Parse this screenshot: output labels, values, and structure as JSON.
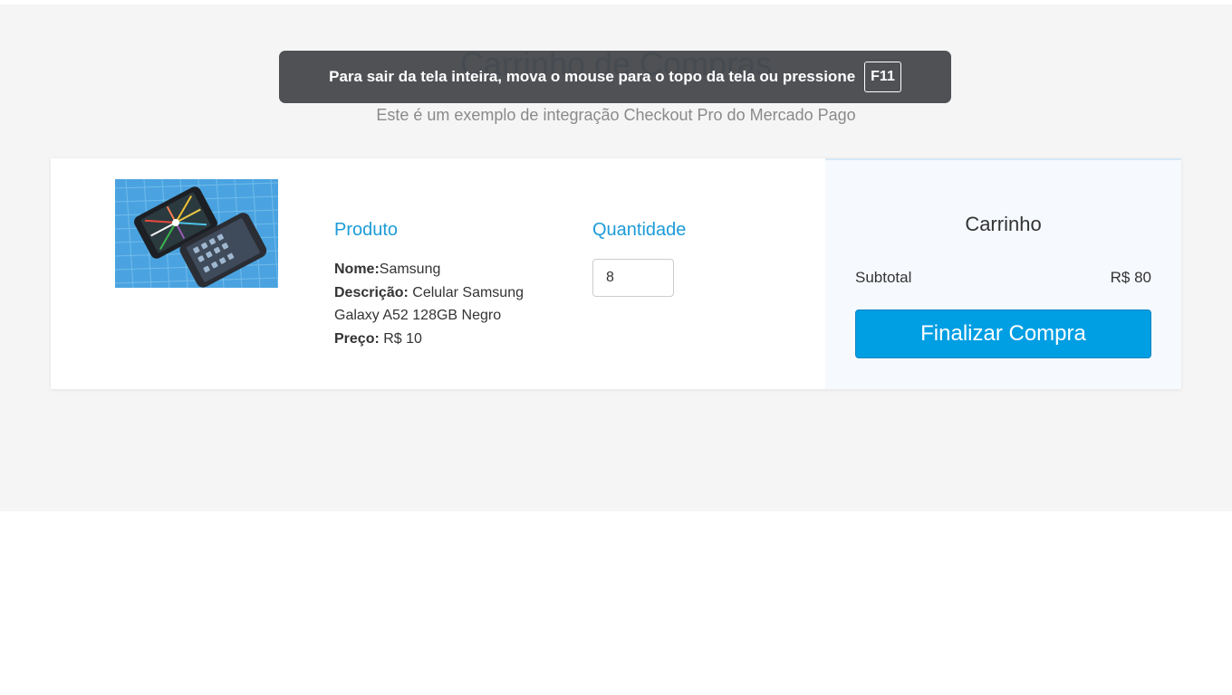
{
  "page": {
    "title": "Carrinho de Compras",
    "subtitle": "Este é um exemplo de integração Checkout Pro do Mercado Pago"
  },
  "fullscreen_notice": {
    "text": "Para sair da tela inteira, mova o mouse para o topo da tela ou pressione",
    "key": "F11"
  },
  "product": {
    "image_icon": "smartphones-photo",
    "section_title": "Produto",
    "name_label": "Nome:",
    "name_value": "Samsung",
    "description_label": "Descrição:",
    "description_value": " Celular Samsung Galaxy A52 128GB Negro",
    "price_label": "Preço:",
    "price_value": " R$ 10"
  },
  "quantity": {
    "section_title": "Quantidade",
    "value": "8"
  },
  "summary": {
    "title": "Carrinho",
    "subtotal_label": "Subtotal",
    "subtotal_value": "R$ 80",
    "checkout_label": "Finalizar Compra"
  },
  "colors": {
    "accent": "#009ee3",
    "section_title": "#1d9bd8",
    "page_title": "#29618c",
    "background": "#f5f5f5",
    "summary_bg": "#f6f9fe"
  }
}
